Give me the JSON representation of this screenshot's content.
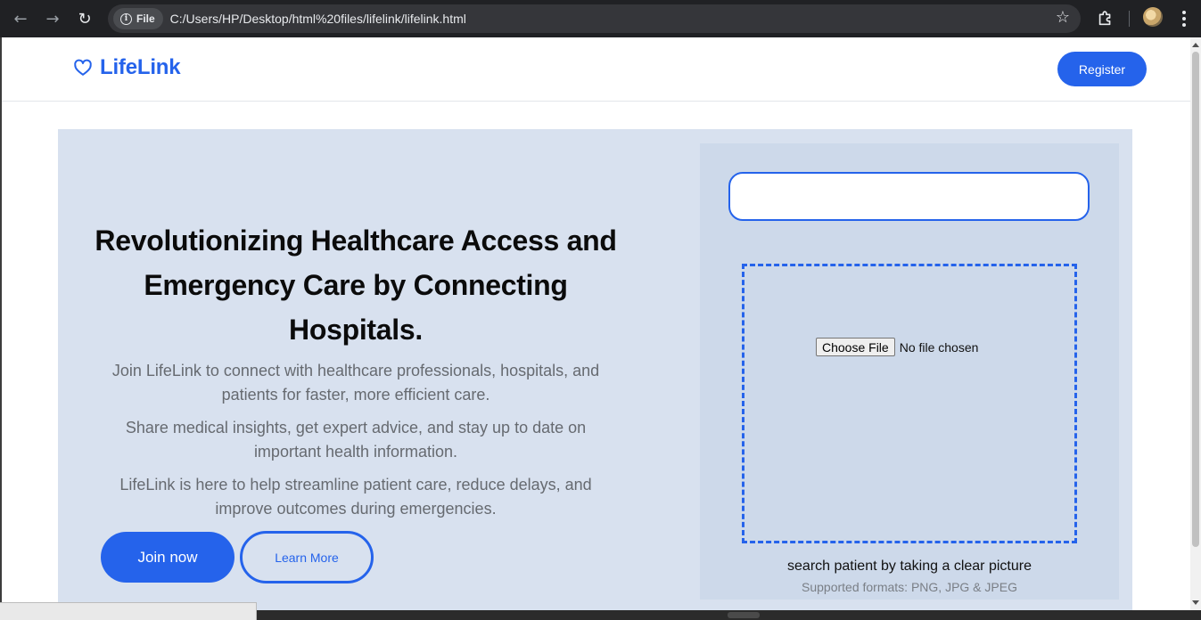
{
  "browser": {
    "file_chip_label": "File",
    "url": "C:/Users/HP/Desktop/html%20files/lifelink/lifelink.html"
  },
  "header": {
    "logo_text": "LifeLink",
    "register_label": "Register"
  },
  "hero": {
    "title": "Revolutionizing Healthcare Access and Emergency Care by Connecting Hospitals.",
    "paragraphs": [
      "Join LifeLink to connect with healthcare professionals, hospitals, and patients for faster, more efficient care.",
      "Share medical insights, get expert advice, and stay up to date on important health information.",
      "LifeLink is here to help streamline patient care, reduce delays, and improve outcomes during emergencies."
    ],
    "join_label": "Join now",
    "learn_label": "Learn More"
  },
  "upload": {
    "search_value": "",
    "choose_file_label": "Choose File",
    "file_status": "No file chosen",
    "caption": "search patient by taking a clear picture",
    "formats": "Supported formats: PNG, JPG & JPEG"
  },
  "colors": {
    "accent": "#2563eb",
    "hero_bg": "#d8e1ef",
    "panel_bg": "#cdd9ea"
  },
  "icons": {
    "logo": "heart-outline-icon",
    "star": "star-outline-icon",
    "extensions": "puzzle-icon",
    "menu": "vertical-dots-icon"
  }
}
